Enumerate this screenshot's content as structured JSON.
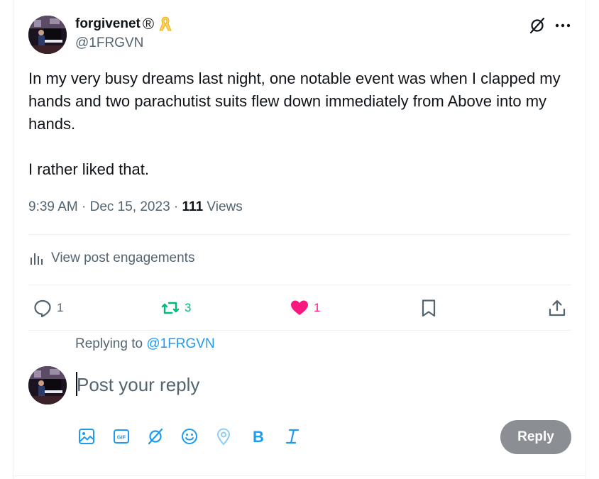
{
  "author": {
    "display_name": "forgivenet",
    "registered_mark": "®",
    "handle": "@1FRGVN"
  },
  "post": {
    "paragraphs": [
      "In my very busy dreams last night, one notable event was when I clapped my hands and two parachutist suits flew down immediately from Above into my hands.",
      "I rather liked that."
    ],
    "time": "9:39 AM",
    "separator": "·",
    "date": "Dec 15, 2023",
    "views_count": "111",
    "views_label": "Views"
  },
  "engagements_link": "View post engagements",
  "actions": {
    "reply_count": "1",
    "repost_count": "3",
    "like_count": "1"
  },
  "reply_box": {
    "replying_to_label": "Replying to",
    "replying_to_handle": "@1FRGVN",
    "placeholder": "Post your reply",
    "reply_button": "Reply"
  },
  "toolbar_icons": [
    "image-icon",
    "gif-icon",
    "grok-icon",
    "emoji-icon",
    "location-icon",
    "bold-icon",
    "italic-icon"
  ],
  "colors": {
    "accent": "#1d9bf0",
    "repost": "#00ba7c",
    "like": "#f91880",
    "muted": "#536471",
    "reply_button_disabled": "#8b8f93",
    "ribbon": "#ffd15c"
  }
}
